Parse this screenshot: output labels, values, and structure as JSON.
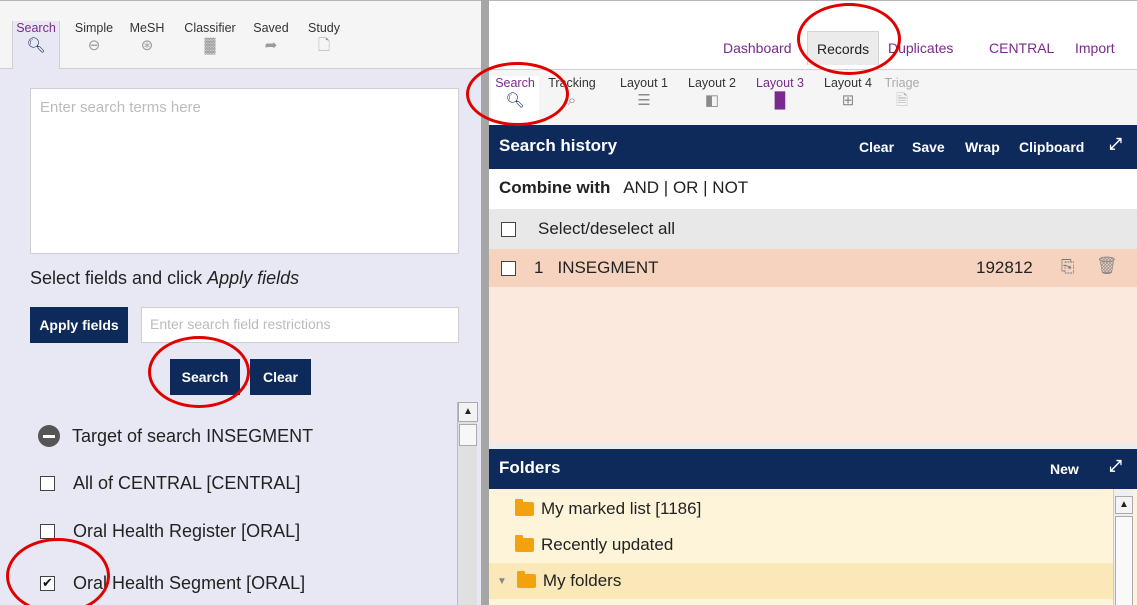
{
  "left_tabs": [
    {
      "label": "Search",
      "icon": "search-icon"
    },
    {
      "label": "Simple",
      "icon": "zoom-out-icon"
    },
    {
      "label": "MeSH",
      "icon": "zoom-tree-icon"
    },
    {
      "label": "Classifier",
      "icon": "bar-chart-icon"
    },
    {
      "label": "Saved",
      "icon": "share-arrow-icon"
    },
    {
      "label": "Study",
      "icon": "document-icon"
    }
  ],
  "search_box": {
    "placeholder": "Enter search terms here"
  },
  "fields": {
    "label_prefix": "Select fields and click ",
    "label_em": "Apply fields",
    "apply_button": "Apply fields",
    "input_placeholder": "Enter search field restrictions"
  },
  "actions": {
    "search": "Search",
    "clear": "Clear"
  },
  "target": {
    "label": "Target of search INSEGMENT"
  },
  "sources": [
    {
      "label": "All of CENTRAL [CENTRAL]",
      "checked": false
    },
    {
      "label": "Oral Health Register [ORAL]",
      "checked": false
    },
    {
      "label": "Oral Health Segment [ORAL]",
      "checked": true
    }
  ],
  "nav": {
    "dashboard": "Dashboard",
    "records": "Records",
    "duplicates": "Duplicates",
    "central": "CENTRAL",
    "import": "Import"
  },
  "right_tabs": [
    {
      "label": "Search",
      "icon": "search-icon"
    },
    {
      "label": "Tracking",
      "icon": "tracking-icon"
    },
    {
      "label": "Layout 1",
      "icon": "layout-1-icon"
    },
    {
      "label": "Layout 2",
      "icon": "layout-2-icon"
    },
    {
      "label": "Layout 3",
      "icon": "layout-3-icon"
    },
    {
      "label": "Layout 4",
      "icon": "layout-4-icon"
    },
    {
      "label": "Triage",
      "icon": "triage-icon"
    }
  ],
  "search_history": {
    "title": "Search history",
    "actions": {
      "clear": "Clear",
      "save": "Save",
      "wrap": "Wrap",
      "clipboard": "Clipboard"
    },
    "combine_label": "Combine with",
    "combine_ops": "AND | OR | NOT",
    "select_all": "Select/deselect all",
    "rows": [
      {
        "num": "1",
        "query": "INSEGMENT",
        "count": "192812"
      }
    ]
  },
  "folders": {
    "title": "Folders",
    "new": "New",
    "items": [
      "My marked list [1186]",
      "Recently updated",
      "My folders"
    ]
  },
  "colors": {
    "navy": "#0e2a5b",
    "accent_purple": "#7a2a8c",
    "history_row": "#f6d3bf",
    "folder": "#f2a20c",
    "annotation_red": "#e00000"
  }
}
